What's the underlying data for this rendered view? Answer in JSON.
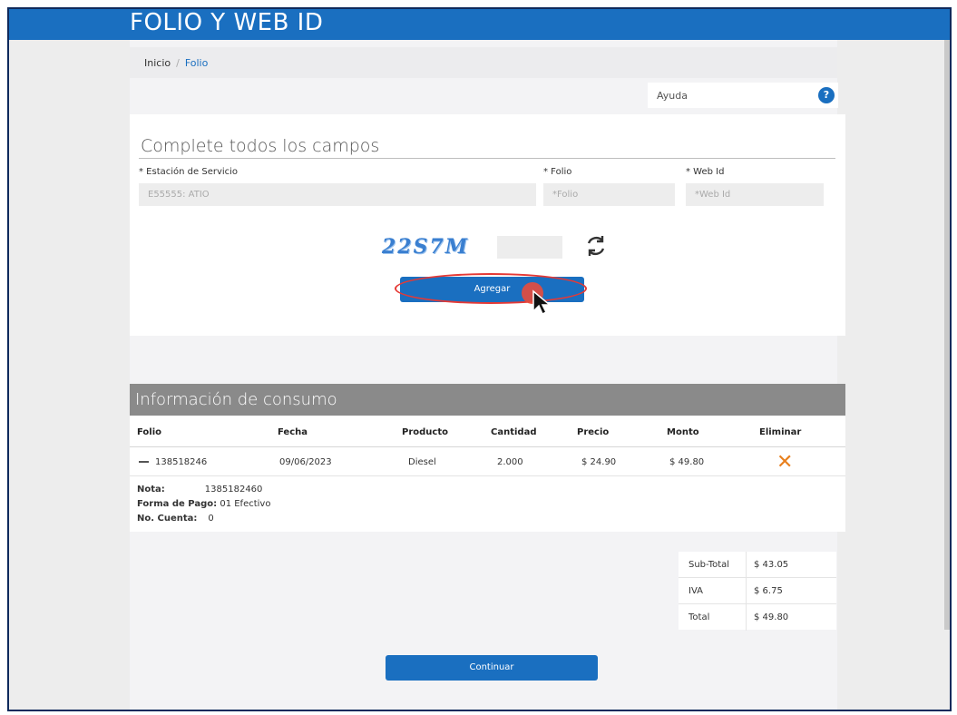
{
  "header": {
    "title": "FOLIO Y WEB ID"
  },
  "breadcrumb": {
    "home": "Inicio",
    "separator": "/",
    "current": "Folio"
  },
  "help": {
    "label": "Ayuda",
    "icon": "question-icon",
    "icon_glyph": "?"
  },
  "form": {
    "heading": "Complete todos los campos",
    "station_label": "* Estación de Servicio",
    "station_value": "E55555: ATIO",
    "folio_label": "* Folio",
    "folio_placeholder": "*Folio",
    "webid_label": "* Web Id",
    "webid_placeholder": "*Web Id",
    "captcha_text": "22S7M",
    "add_button": "Agregar"
  },
  "consumo": {
    "title": "Información de consumo",
    "columns": [
      "Folio",
      "Fecha",
      "Producto",
      "Cantidad",
      "Precio",
      "Monto",
      "Eliminar"
    ],
    "row": {
      "folio": "138518246",
      "fecha": "09/06/2023",
      "producto": "Diesel",
      "cantidad": "2.000",
      "precio": "$ 24.90",
      "monto": "$ 49.80"
    },
    "details": {
      "nota_label": "Nota:",
      "nota_value": "1385182460",
      "pago_label": "Forma de Pago:",
      "pago_value": "01 Efectivo",
      "cuenta_label": "No. Cuenta:",
      "cuenta_value": "0"
    }
  },
  "totals": {
    "subtotal_label": "Sub-Total",
    "subtotal_value": "$ 43.05",
    "iva_label": "IVA",
    "iva_value": "$ 6.75",
    "total_label": "Total",
    "total_value": "$ 49.80"
  },
  "continue_button": "Continuar",
  "colors": {
    "brand": "#1a6fc0",
    "delete": "#e8801e",
    "highlight": "#e53935"
  }
}
